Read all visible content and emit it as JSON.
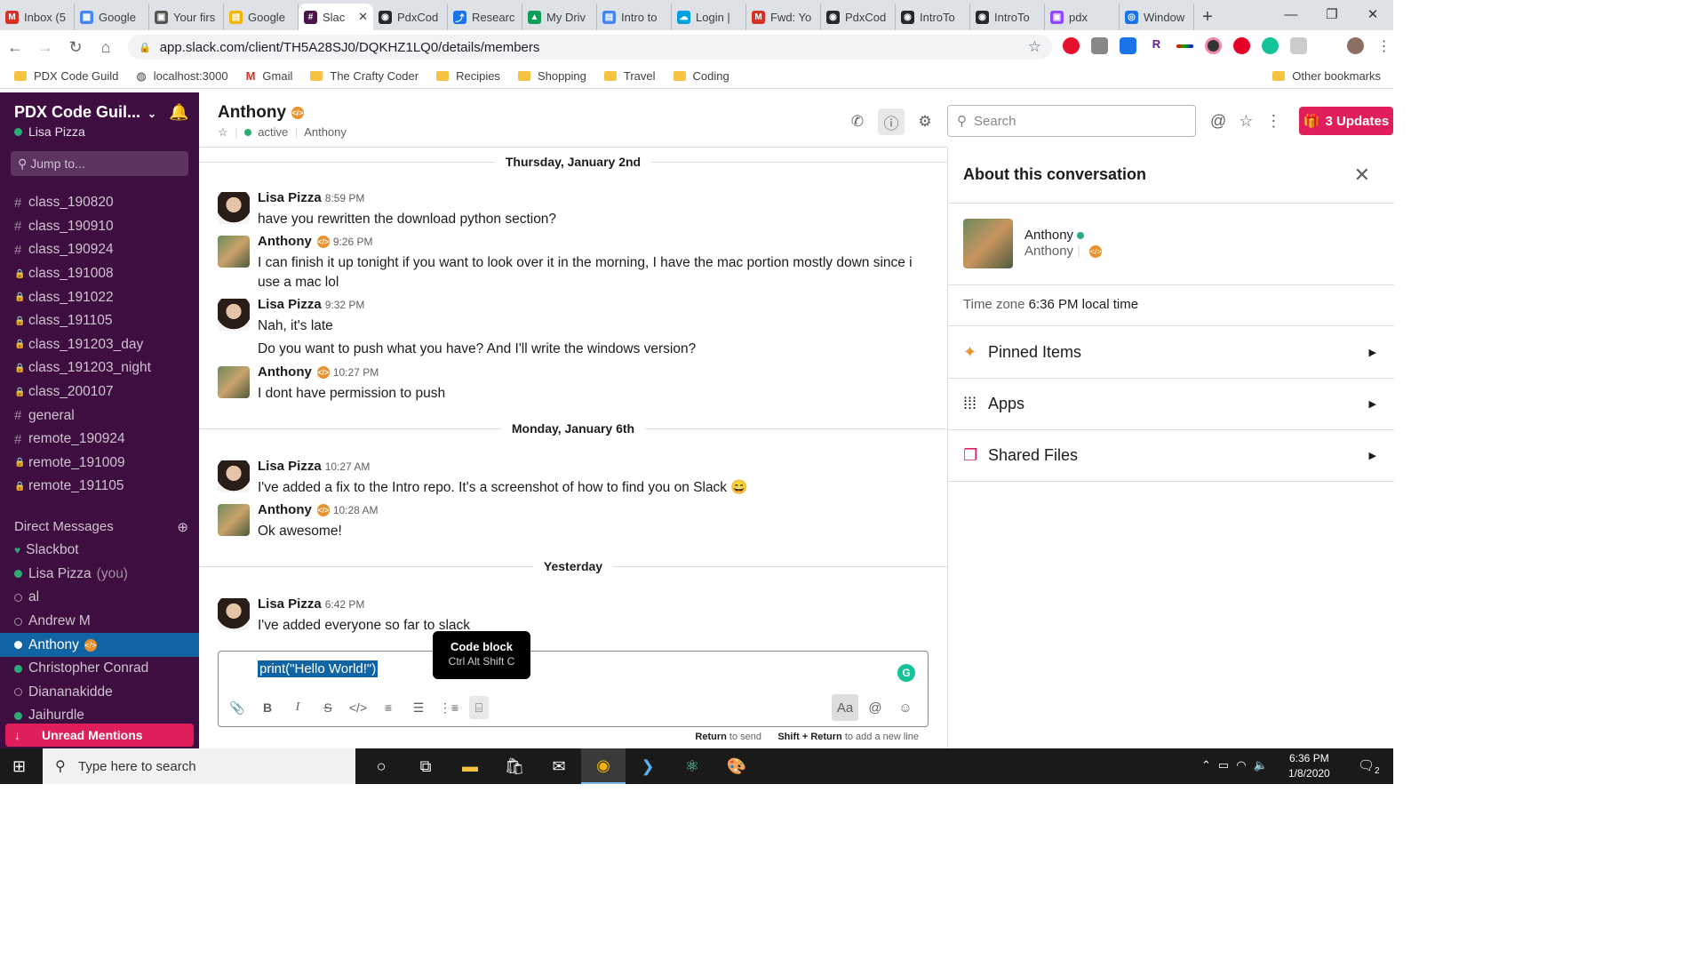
{
  "browser": {
    "tabs": [
      {
        "label": "Inbox (5",
        "color": "#d93025",
        "glyph": "M"
      },
      {
        "label": "Google",
        "color": "#4285f4",
        "glyph": "▦"
      },
      {
        "label": "Your firs",
        "color": "#555",
        "glyph": "▣"
      },
      {
        "label": "Google",
        "color": "#f4b400",
        "glyph": "▤"
      },
      {
        "label": "Slac",
        "color": "#4a154b",
        "glyph": "#",
        "active": true
      },
      {
        "label": "PdxCod",
        "color": "#24292e",
        "glyph": "◉"
      },
      {
        "label": "Researc",
        "color": "#1a73e8",
        "glyph": "⤴"
      },
      {
        "label": "My Driv",
        "color": "#0f9d58",
        "glyph": "▲"
      },
      {
        "label": "Intro to",
        "color": "#4285f4",
        "glyph": "▤"
      },
      {
        "label": "Login |",
        "color": "#00a1e0",
        "glyph": "☁"
      },
      {
        "label": "Fwd: Yo",
        "color": "#d93025",
        "glyph": "M"
      },
      {
        "label": "PdxCod",
        "color": "#24292e",
        "glyph": "◉"
      },
      {
        "label": "IntroTo",
        "color": "#24292e",
        "glyph": "◉"
      },
      {
        "label": "IntroTo",
        "color": "#24292e",
        "glyph": "◉"
      },
      {
        "label": "pdx",
        "color": "#9146ff",
        "glyph": "▣"
      },
      {
        "label": "Window",
        "color": "#1a73e8",
        "glyph": "◎"
      }
    ],
    "new_tab": "+",
    "window_controls": [
      "—",
      "❐",
      "✕"
    ],
    "url": "app.slack.com/client/TH5A28SJ0/DQKHZ1LQ0/details/members",
    "bookmarks": [
      "PDX Code Guild",
      "localhost:3000",
      "Gmail",
      "The Crafty Coder",
      "Recipies",
      "Shopping",
      "Travel",
      "Coding"
    ],
    "other_bookmarks": "Other bookmarks"
  },
  "sidebar": {
    "workspace": "PDX Code Guil...",
    "user": "Lisa Pizza",
    "jump_to": "Jump to...",
    "channels": [
      {
        "icon": "#",
        "name": "class_190820"
      },
      {
        "icon": "#",
        "name": "class_190910"
      },
      {
        "icon": "#",
        "name": "class_190924"
      },
      {
        "icon": "🔒",
        "name": "class_191008"
      },
      {
        "icon": "🔒",
        "name": "class_191022"
      },
      {
        "icon": "🔒",
        "name": "class_191105"
      },
      {
        "icon": "🔒",
        "name": "class_191203_day"
      },
      {
        "icon": "🔒",
        "name": "class_191203_night"
      },
      {
        "icon": "🔒",
        "name": "class_200107"
      },
      {
        "icon": "#",
        "name": "general"
      },
      {
        "icon": "#",
        "name": "remote_190924"
      },
      {
        "icon": "🔒",
        "name": "remote_191009"
      },
      {
        "icon": "🔒",
        "name": "remote_191105"
      }
    ],
    "dm_header": "Direct Messages",
    "dms": [
      {
        "name": "Slackbot",
        "status": "heart"
      },
      {
        "name": "Lisa Pizza",
        "suffix": "(you)",
        "status": "on"
      },
      {
        "name": "al",
        "status": "off"
      },
      {
        "name": "Andrew M",
        "status": "off"
      },
      {
        "name": "Anthony",
        "status": "on",
        "selected": true
      },
      {
        "name": "Christopher Conrad",
        "status": "on"
      },
      {
        "name": "Diananakidde",
        "status": "off"
      },
      {
        "name": "Jaihurdle",
        "status": "on"
      }
    ],
    "unread_mentions": "Unread Mentions"
  },
  "channel": {
    "name": "Anthony",
    "status": "active",
    "subtitle": "Anthony"
  },
  "messages": {
    "day1": "Thursday, January 2nd",
    "day2": "Monday, January 6th",
    "day3": "Yesterday",
    "items": [
      {
        "author": "Lisa Pizza",
        "time": "8:59 PM",
        "lines": [
          "have you rewritten the download python section?"
        ]
      },
      {
        "author": "Anthony",
        "time": "9:26 PM",
        "lines": [
          "I can finish it up tonight if you want to look over it in the morning, I have the mac portion mostly down since i use a mac lol"
        ]
      },
      {
        "author": "Lisa Pizza",
        "time": "9:32 PM",
        "lines": [
          "Nah, it's late",
          "Do you want to push what you have? And I'll write the windows version?"
        ]
      },
      {
        "author": "Anthony",
        "time": "10:27 PM",
        "lines": [
          "I dont have permission to push"
        ]
      },
      {
        "author": "Lisa Pizza",
        "time": "10:27 AM",
        "lines": [
          "I've added a fix to the Intro repo. It's a screenshot of how to find you on Slack 😄"
        ]
      },
      {
        "author": "Anthony",
        "time": "10:28 AM",
        "lines": [
          "Ok awesome!"
        ]
      },
      {
        "author": "Lisa Pizza",
        "time": "6:42 PM",
        "lines": [
          "I've added everyone so far to slack"
        ]
      }
    ]
  },
  "composer": {
    "value": "print(\"Hello World!\")",
    "tooltip_title": "Code block",
    "tooltip_shortcut": "Ctrl Alt Shift C",
    "hint_key1": "Return",
    "hint_text1": "to send",
    "hint_key2": "Shift + Return",
    "hint_text2": "to add a new line",
    "format_label": "Aa"
  },
  "top": {
    "search_placeholder": "Search",
    "updates": "3 Updates"
  },
  "details": {
    "title": "About this conversation",
    "name": "Anthony",
    "display_name": "Anthony",
    "timezone_label": "Time zone",
    "timezone_value": "6:36 PM local time",
    "rows": [
      "Pinned Items",
      "Apps",
      "Shared Files"
    ]
  },
  "taskbar": {
    "search": "Type here to search",
    "time": "6:36 PM",
    "date": "1/8/2020",
    "notifications": "2"
  }
}
